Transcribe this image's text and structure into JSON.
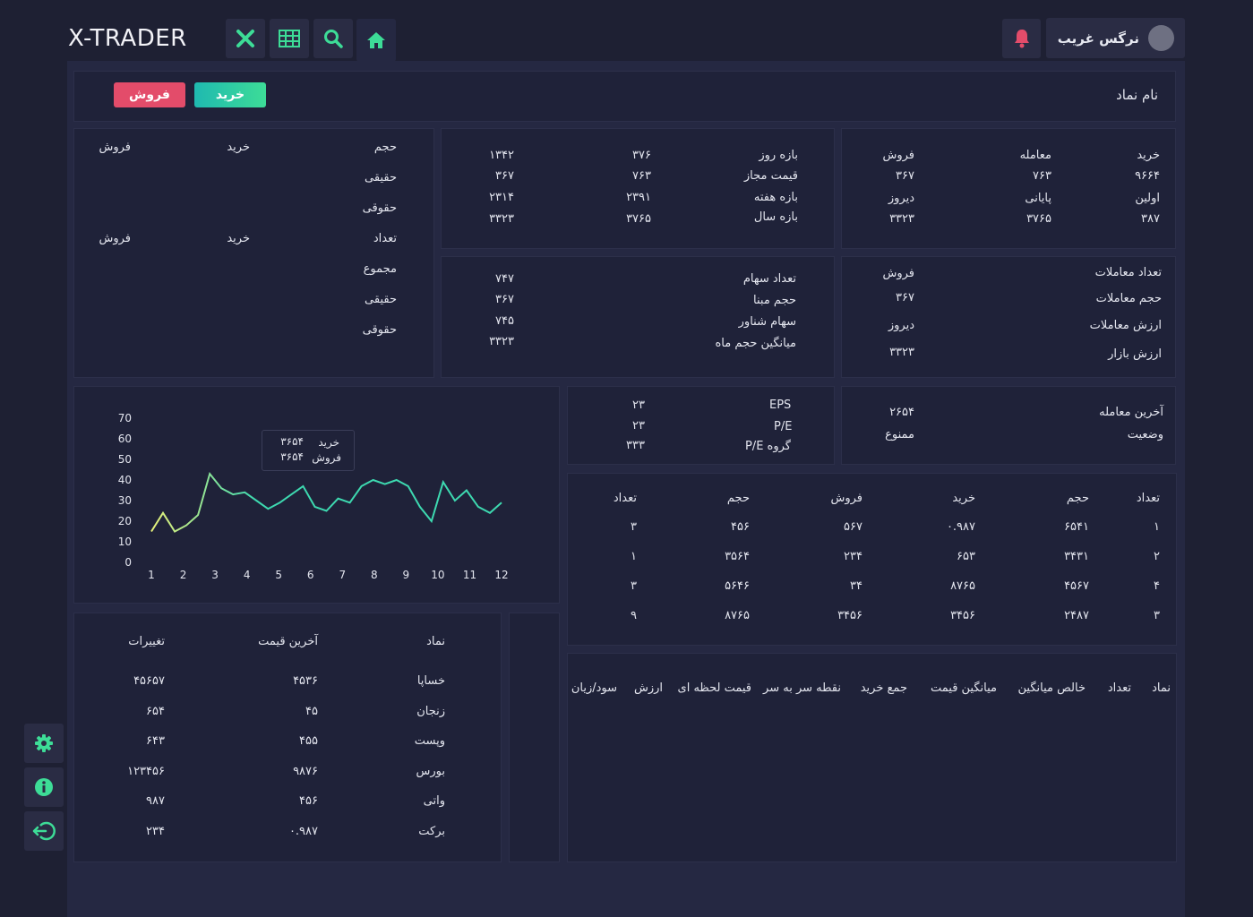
{
  "app": {
    "logo": "X-TRADER"
  },
  "header": {
    "user_name": "نرگس غریب"
  },
  "symbol_bar": {
    "label": "نام نماد",
    "buy": "خرید",
    "sell": "فروش"
  },
  "colors": {
    "accent": "#3ddc97",
    "buy": "#26c9a6",
    "sell": "#e34c6a",
    "bell": "#e34c6a",
    "line_start": "#e6f07a",
    "line_end": "#3dd9b0"
  },
  "icons": {
    "x": "x-icon",
    "grid": "table-icon",
    "search": "search-icon",
    "home": "home-icon",
    "bell": "bell-icon",
    "gear": "gear-icon",
    "info": "info-icon",
    "logout": "logout-icon"
  },
  "orderbook": {
    "headers": [
      "خرید",
      "معامله",
      "فروش"
    ],
    "row1": [
      "۹۶۶۴",
      "۷۶۳",
      "۳۶۷"
    ],
    "headers2": [
      "اولین",
      "پایانی",
      "دیروز"
    ],
    "row2": [
      "۳۸۷",
      "۳۷۶۵",
      "۳۳۲۳"
    ]
  },
  "ranges": {
    "labels": [
      "بازه روز",
      "قیمت مجاز",
      "بازه هفته",
      "بازه سال"
    ],
    "col1": [
      "۳۷۶",
      "۷۶۳",
      "۲۳۹۱",
      "۳۷۶۵"
    ],
    "col2": [
      "۱۳۴۲",
      "۳۶۷",
      "۲۳۱۴",
      "۳۳۲۳"
    ]
  },
  "volume_panel": {
    "hajm": "حجم",
    "kharid": "خرید",
    "forush": "فروش",
    "haghighi": "حقیقی",
    "hoghooghi": "حقوقی",
    "tedad": "تعداد",
    "majmoo": "مجموع"
  },
  "trades_panel": {
    "labels": [
      "تعداد معاملات",
      "حجم معاملات",
      "ارزش معاملات",
      "ارزش بازار"
    ],
    "values": [
      "فروش",
      "۳۶۷",
      "دیروز",
      "۳۳۲۳"
    ]
  },
  "shares_panel": {
    "labels": [
      "تعداد سهام",
      "حجم مبنا",
      "سهام شناور",
      "میانگین حجم ماه"
    ],
    "values": [
      "۷۴۷",
      "۳۶۷",
      "۷۴۵",
      "۳۳۲۳"
    ]
  },
  "status_panel": {
    "last_trade_label": "آخرین معامله",
    "last_trade_value": "۲۶۵۴",
    "status_label": "وضعیت",
    "status_value": "ممنوع"
  },
  "eps_panel": {
    "labels": [
      "EPS",
      "P/E",
      "گروه P/E"
    ],
    "values": [
      "۲۳",
      "۲۳",
      "۳۳۳"
    ]
  },
  "depth_table": {
    "headers": [
      "تعداد",
      "حجم",
      "خرید",
      "فروش",
      "حجم",
      "تعداد"
    ],
    "rows": [
      [
        "۱",
        "۶۵۴۱",
        "۰.۹۸۷",
        "۵۶۷",
        "۴۵۶",
        "۳"
      ],
      [
        "۲",
        "۳۴۳۱",
        "۶۵۳",
        "۲۳۴",
        "۳۵۶۴",
        "۱"
      ],
      [
        "۴",
        "۴۵۶۷",
        "۸۷۶۵",
        "۳۴",
        "۵۶۴۶",
        "۳"
      ],
      [
        "۳",
        "۲۴۸۷",
        "۳۴۵۶",
        "۳۴۵۶",
        "۸۷۶۵",
        "۹"
      ]
    ]
  },
  "portfolio": {
    "headers": [
      "نماد",
      "تعداد",
      "خالص میانگین",
      "میانگین قیمت",
      "جمع خرید",
      "نقطه سر به سر",
      "قیمت لحظه ای",
      "ارزش",
      "سود/زیان"
    ]
  },
  "watchlist": {
    "headers": [
      "نماد",
      "آخرین قیمت",
      "تغییرات"
    ],
    "rows": [
      [
        "خساپا",
        "۴۵۳۶",
        "۴۵۶۵۷"
      ],
      [
        "زنجان",
        "۴۵",
        "۶۵۴"
      ],
      [
        "وپست",
        "۴۵۵",
        "۶۴۳"
      ],
      [
        "بورس",
        "۹۸۷۶",
        "۱۲۳۴۵۶"
      ],
      [
        "واتی",
        "۴۵۶",
        "۹۸۷"
      ],
      [
        "برکت",
        "۰.۹۸۷",
        "۲۳۴"
      ]
    ]
  },
  "tooltip": {
    "buy_label": "خرید",
    "buy_value": "۳۶۵۴",
    "sell_label": "فروش",
    "sell_value": "۳۶۵۴"
  },
  "chart_data": {
    "type": "line",
    "x_ticks": [
      "1",
      "2",
      "3",
      "4",
      "5",
      "6",
      "7",
      "8",
      "9",
      "10",
      "11",
      "12"
    ],
    "y_ticks": [
      "0",
      "10",
      "20",
      "30",
      "40",
      "50",
      "60",
      "70"
    ],
    "ylim": [
      0,
      70
    ],
    "xlim": [
      1,
      12
    ],
    "x": [
      1,
      1.33,
      1.67,
      2,
      2.33,
      2.67,
      3,
      3.33,
      3.67,
      4,
      4.33,
      4.67,
      5,
      5.33,
      5.67,
      6,
      6.33,
      6.67,
      7,
      7.33,
      7.67,
      8,
      8.33,
      8.67,
      9,
      9.33,
      9.67,
      10,
      10.33,
      10.67,
      11,
      11.33,
      11.67,
      12
    ],
    "values": [
      15,
      24,
      15,
      18,
      23,
      43,
      36,
      33,
      34,
      30,
      26,
      29,
      33,
      37,
      27,
      25,
      31,
      29,
      37,
      40,
      38,
      40,
      37,
      27,
      20,
      39,
      30,
      35,
      27,
      24,
      29
    ]
  }
}
